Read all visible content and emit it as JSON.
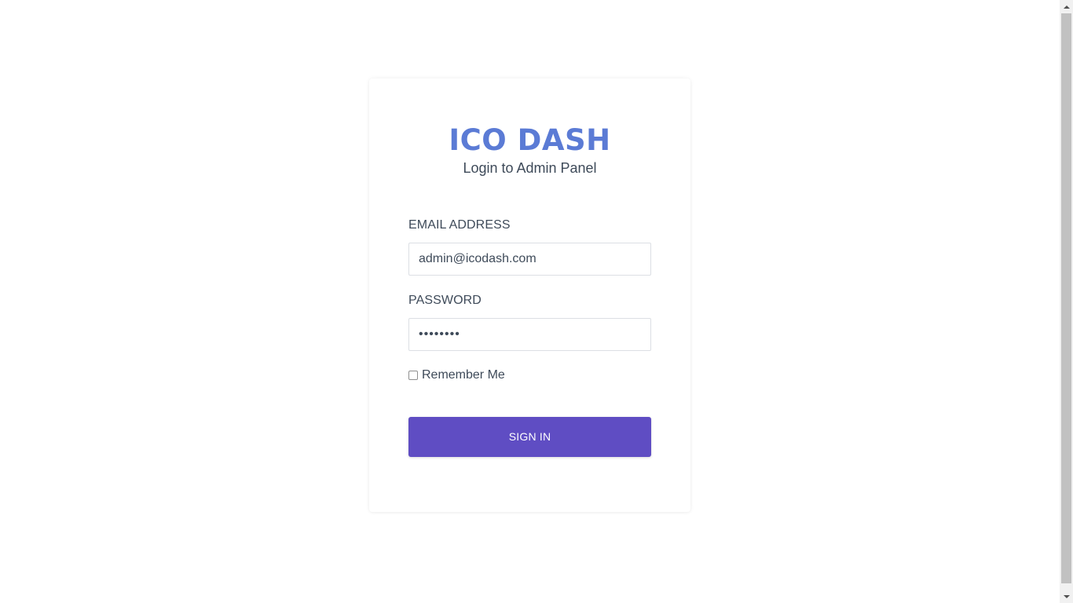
{
  "login": {
    "logo_text": "ICO DASH",
    "subtitle": "Login to Admin Panel",
    "email_label": "EMAIL ADDRESS",
    "email_value": "admin@icodash.com",
    "password_label": "PASSWORD",
    "password_value": "12345678",
    "remember_label": "Remember Me",
    "remember_checked": false,
    "signin_label": "SIGN IN"
  },
  "colors": {
    "logo": "#5b7bd5",
    "button": "#5f4dc3",
    "text": "#3e4a59"
  },
  "icons": {
    "scroll_up": "triangle-up",
    "scroll_down": "triangle-down"
  }
}
